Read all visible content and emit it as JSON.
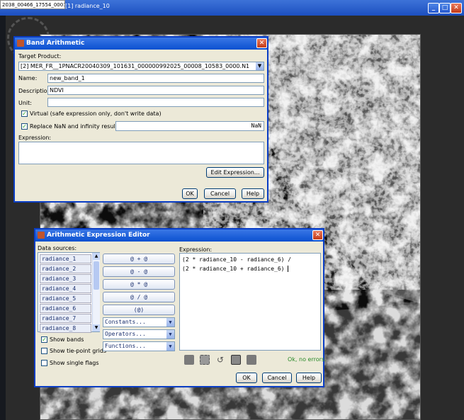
{
  "outer_window": {
    "tab_title": "2038_00466_17554_0001",
    "title_text": "[1] radiance_10"
  },
  "band_arithmetic": {
    "title": "Band Arithmetic",
    "target_product_label": "Target Product:",
    "target_product_value": "[2] MER_FR__1PNACR20040309_101631_000000992025_00008_10583_0000.N1",
    "name_label": "Name:",
    "name_value": "new_band_1",
    "description_label": "Description:",
    "description_value": "NDVI",
    "unit_label": "Unit:",
    "unit_value": "",
    "virtual_label": "Virtual (safe expression only, don't write data)",
    "replace_label": "Replace NaN and infinity results by",
    "replace_value": "NaN",
    "expression_label": "Expression:",
    "edit_expression_button": "Edit Expression...",
    "ok_button": "OK",
    "cancel_button": "Cancel",
    "help_button": "Help"
  },
  "expression_editor": {
    "title": "Arithmetic Expression Editor",
    "data_sources_label": "Data sources:",
    "data_sources": [
      "radiance_1",
      "radiance_2",
      "radiance_3",
      "radiance_4",
      "radiance_5",
      "radiance_6",
      "radiance_7",
      "radiance_8"
    ],
    "operators": [
      "@ + @",
      "@ - @",
      "@ * @",
      "@ / @",
      "(@)"
    ],
    "combos": [
      "Constants...",
      "Operators...",
      "Functions..."
    ],
    "show_bands_label": "Show bands",
    "show_tiepoint_label": "Show tie-point grids",
    "show_flags_label": "Show single flags",
    "expression_label": "Expression:",
    "expression_line1": "(2 * radiance_10 - radiance_6) /",
    "expression_line2": "(2 * radiance_10 + radiance_6)",
    "status": "Ok, no errors.",
    "ok_button": "OK",
    "cancel_button": "Cancel",
    "help_button": "Help"
  },
  "colors": {
    "title_blue": "#0a50d0",
    "status_green": "#2a8a2a"
  }
}
